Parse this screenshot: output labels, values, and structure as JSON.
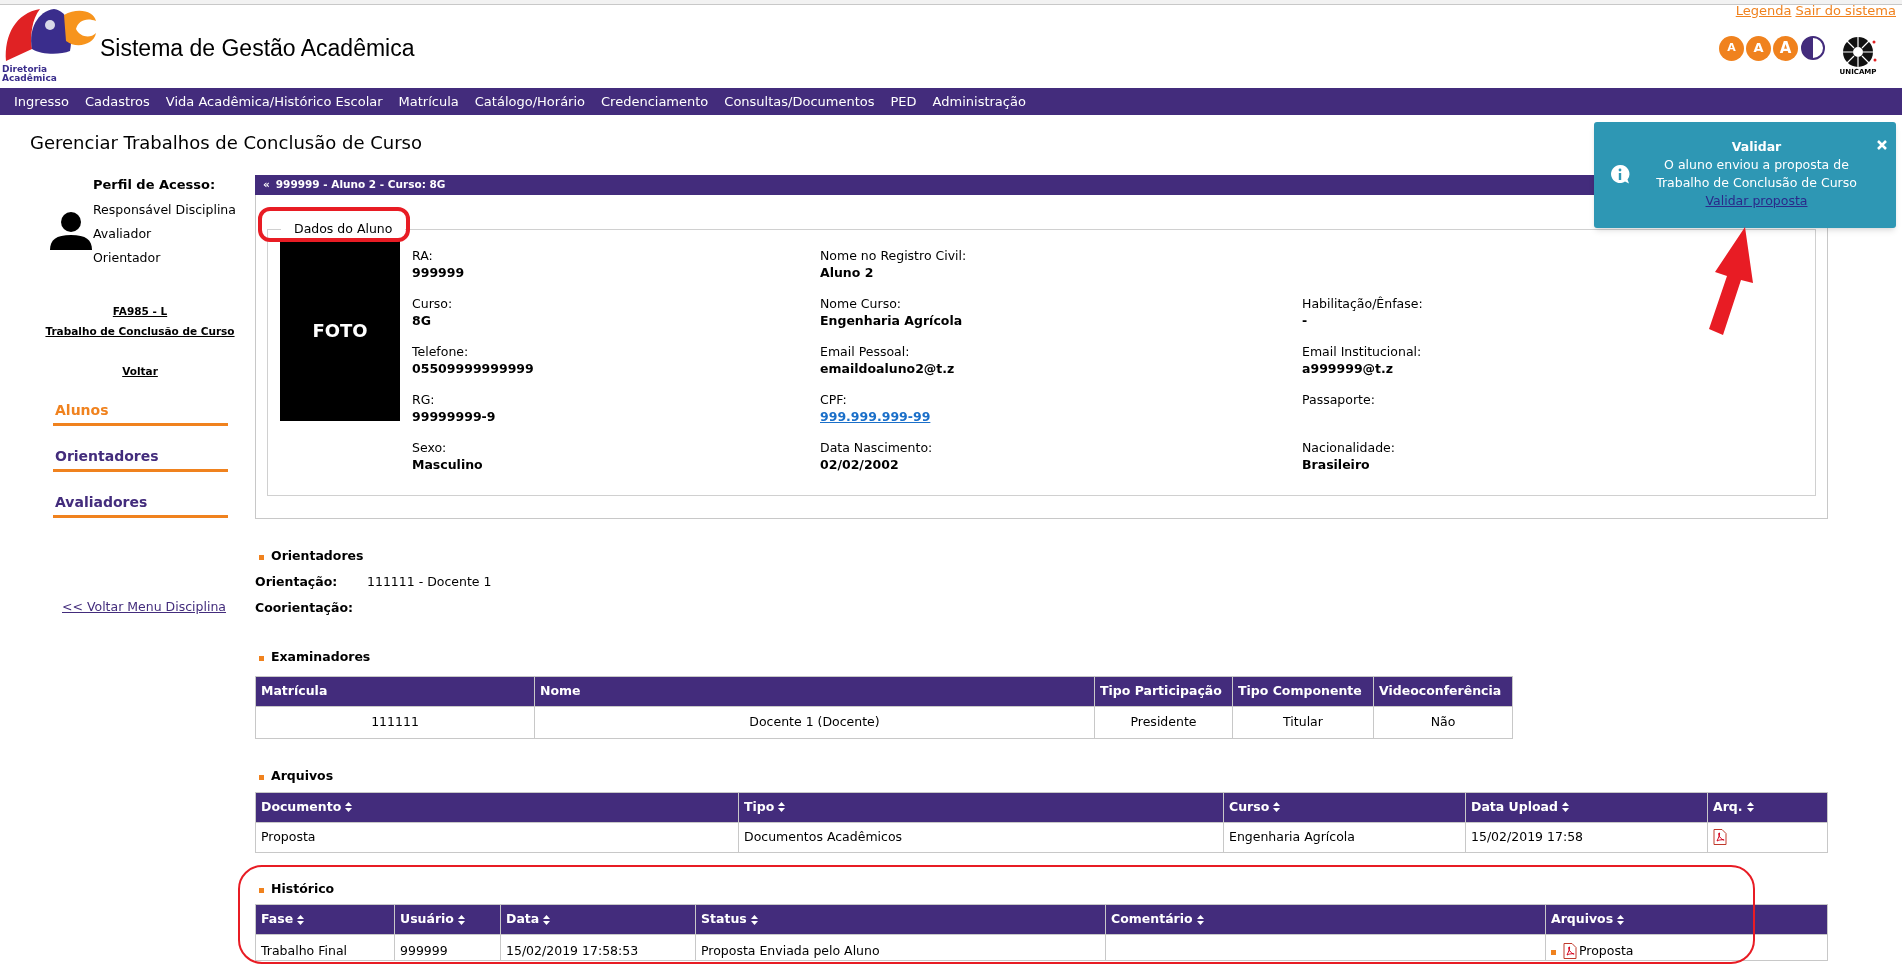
{
  "header": {
    "title": "Sistema de Gestão Acadêmica",
    "logo_caption": "Diretoria Acadêmica",
    "top_links": [
      "Legenda",
      "Sair do sistema"
    ],
    "font_buttons": [
      "A",
      "A",
      "A"
    ],
    "university": "UNICAMP"
  },
  "nav": {
    "items": [
      "Ingresso",
      "Cadastros",
      "Vida Acadêmica/Histórico Escolar",
      "Matrícula",
      "Catálogo/Horário",
      "Credenciamento",
      "Consultas/Documentos",
      "PED",
      "Administração"
    ]
  },
  "page_title": "Gerenciar Trabalhos de Conclusão de Curso",
  "sidebar": {
    "profile_label": "Perfil de Acesso:",
    "profiles": [
      "Responsável Disciplina",
      "Avaliador",
      "Orientador"
    ],
    "course_code": "FA985 - L",
    "course_name": "Trabalho de Conclusão de Curso",
    "back_link": "Voltar",
    "sections": [
      {
        "label": "Alunos",
        "selected": true
      },
      {
        "label": "Orientadores",
        "selected": false
      },
      {
        "label": "Avaliadores",
        "selected": false
      }
    ],
    "menu_link": "<< Voltar Menu Disciplina"
  },
  "student_bar": {
    "arrow": "«",
    "text": "999999 - Aluno 2 - Curso: 8G"
  },
  "student_data": {
    "legend": "Dados do Aluno",
    "photo_label": "FOTO",
    "rows": [
      [
        {
          "label": "RA:",
          "value": "999999",
          "kind": "text"
        },
        {
          "label": "Nome no Registro Civil:",
          "value": "Aluno 2",
          "kind": "text"
        }
      ],
      [
        {
          "label": "Curso:",
          "value": "8G",
          "kind": "text"
        },
        {
          "label": "Nome Curso:",
          "value": "Engenharia Agrícola",
          "kind": "text"
        },
        {
          "label": "Habilitação/Ênfase:",
          "value": "-",
          "kind": "text"
        }
      ],
      [
        {
          "label": "Telefone:",
          "value": "05509999999999",
          "kind": "text"
        },
        {
          "label": "Email Pessoal:",
          "value": "emaildoaluno2@t.z",
          "kind": "text"
        },
        {
          "label": "Email Institucional:",
          "value": "a999999@t.z",
          "kind": "text"
        }
      ],
      [
        {
          "label": "RG:",
          "value": "99999999-9",
          "kind": "text"
        },
        {
          "label": "CPF:",
          "value": "999.999.999-99",
          "kind": "link"
        },
        {
          "label": "Passaporte:"
        }
      ],
      [
        {
          "label": "Sexo:",
          "value": "Masculino",
          "kind": "text"
        },
        {
          "label": "Data Nascimento:",
          "value": "02/02/2002",
          "kind": "text"
        },
        {
          "label": "Nacionalidade:",
          "value": "Brasileiro",
          "kind": "text"
        }
      ]
    ]
  },
  "orientadores": {
    "title": "Orientadores",
    "rows": [
      {
        "label": "Orientação:",
        "value": "111111 - Docente 1"
      },
      {
        "label": "Coorientação:"
      }
    ]
  },
  "examinadores": {
    "title": "Examinadores",
    "columns": [
      "Matrícula",
      "Nome",
      "Tipo Participação",
      "Tipo Componente",
      "Videoconferência"
    ],
    "rows": [
      [
        "111111",
        "Docente 1 (Docente)",
        "Presidente",
        "Titular",
        "Não"
      ]
    ]
  },
  "arquivos": {
    "title": "Arquivos",
    "columns": [
      "Documento",
      "Tipo",
      "Curso",
      "Data Upload",
      "Arq."
    ],
    "rows": [
      {
        "cells": [
          "Proposta",
          "Documentos Acadêmicos",
          "Engenharia Agrícola",
          "15/02/2019 17:58"
        ],
        "has_file": true
      }
    ]
  },
  "historico": {
    "title": "Histórico",
    "columns": [
      "Fase",
      "Usuário",
      "Data",
      "Status",
      "Comentário",
      "Arquivos"
    ],
    "rows": [
      {
        "cells": [
          "Trabalho Final",
          "999999",
          "15/02/2019 17:58:53",
          "Proposta Enviada pelo Aluno",
          null
        ],
        "file_label": "Proposta"
      }
    ]
  },
  "notification": {
    "title": "Validar",
    "message": "O aluno enviou a proposta de Trabalho de Conclusão de Curso",
    "link": "Validar proposta"
  }
}
